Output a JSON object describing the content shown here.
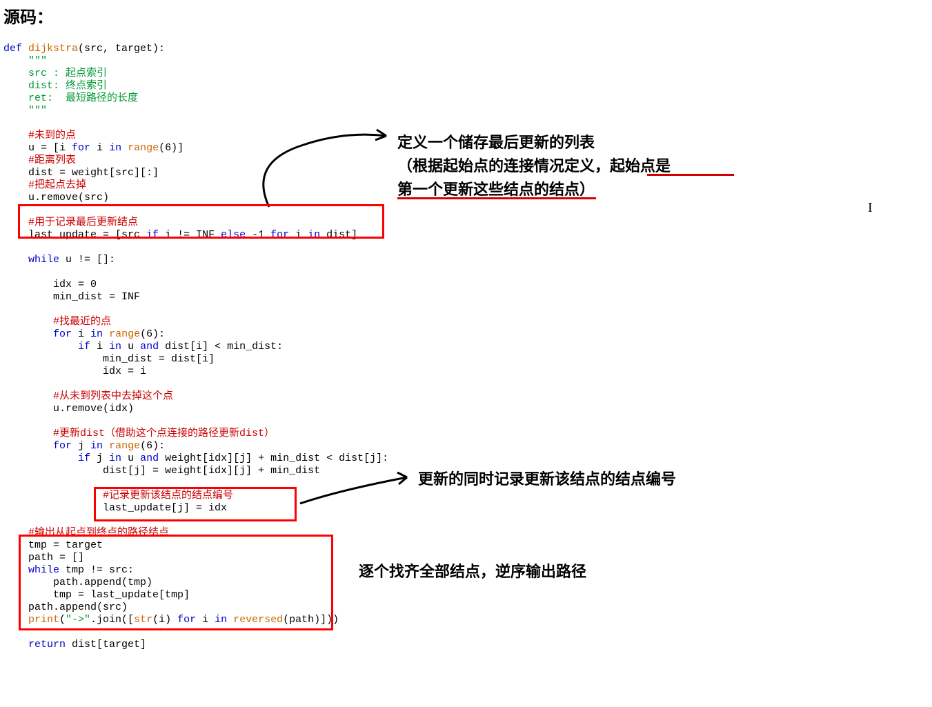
{
  "heading": "源码：",
  "code": {
    "l1a": "def",
    "l1b": " dijkstra",
    "l1c": "(src, target):",
    "l2": "    \"\"\"",
    "l3": "    src : 起点索引",
    "l4": "    dist: 终点索引",
    "l5": "    ret:  最短路径的长度",
    "l6": "    \"\"\"",
    "l7": "    #未到的点",
    "l8a": "    u = [i ",
    "l8b": "for",
    "l8c": " i ",
    "l8d": "in",
    "l8e": " range",
    "l8f": "(6)]",
    "l9": "    #距离列表",
    "l10": "    dist = weight[src][:]",
    "l11": "    #把起点去掉",
    "l12": "    u.remove(src)",
    "l13": "    #用于记录最后更新结点",
    "l14a": "    last_update = [src ",
    "l14b": "if",
    "l14c": " i != INF ",
    "l14d": "else",
    "l14e": " -1 ",
    "l14f": "for",
    "l14g": " i ",
    "l14h": "in",
    "l14i": " dist]",
    "l15a": "    while",
    "l15b": " u != []:",
    "l16": "        idx = 0",
    "l17": "        min_dist = INF",
    "l18": "        #找最近的点",
    "l19a": "        for",
    "l19b": " i ",
    "l19c": "in",
    "l19d": " range",
    "l19e": "(6):",
    "l20a": "            if",
    "l20b": " i ",
    "l20c": "in",
    "l20d": " u ",
    "l20e": "and",
    "l20f": " dist[i] < min_dist:",
    "l21": "                min_dist = dist[i]",
    "l22": "                idx = i",
    "l23": "        #从未到列表中去掉这个点",
    "l24": "        u.remove(idx)",
    "l25": "        #更新dist（借助这个点连接的路径更新dist）",
    "l26a": "        for",
    "l26b": " j ",
    "l26c": "in",
    "l26d": " range",
    "l26e": "(6):",
    "l27a": "            if",
    "l27b": " j ",
    "l27c": "in",
    "l27d": " u ",
    "l27e": "and",
    "l27f": " weight[idx][j] + min_dist < dist[j]:",
    "l28": "                dist[j] = weight[idx][j] + min_dist",
    "l29": "                #记录更新该结点的结点编号",
    "l30": "                last_update[j] = idx",
    "l31": "    #输出从起点到终点的路径结点",
    "l32": "    tmp = target",
    "l33": "    path = []",
    "l34a": "    while",
    "l34b": " tmp != src:",
    "l35": "        path.append(tmp)",
    "l36": "        tmp = last_update[tmp]",
    "l37": "    path.append(src)",
    "l38a": "    print",
    "l38b": "(",
    "l38c": "\"->\"",
    "l38d": ".join([",
    "l38e": "str",
    "l38f": "(i) ",
    "l38g": "for",
    "l38h": " i ",
    "l38i": "in",
    "l38j": " reversed",
    "l38k": "(path)]))",
    "l39a": "    return",
    "l39b": " dist[target]"
  },
  "annotations": {
    "a1_line1": "定义一个储存最后更新的列表",
    "a1_line2": "（根据起始点的连接情况定义，起始点是",
    "a1_line3": "第一个更新这些结点的结点）",
    "a2": "更新的同时记录更新该结点的结点编号",
    "a3": "逐个找齐全部结点，逆序输出路径"
  },
  "colors": {
    "redbox": "#ff0000",
    "keyword": "#0000cc",
    "builtin": "#cc6600",
    "string": "#009933",
    "comment": "#cc0000",
    "underline": "#d40000"
  }
}
